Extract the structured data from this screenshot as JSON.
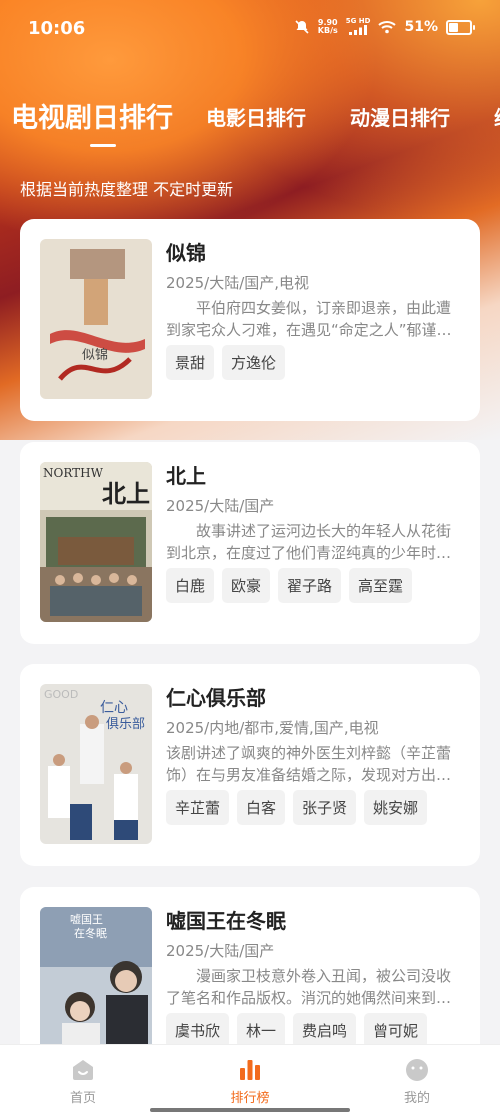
{
  "status_bar": {
    "time": "10:06",
    "net_speed": "9.90",
    "net_unit": "KB/s",
    "net_type": "5G HD",
    "battery": "51%",
    "icons": [
      "dnd-icon",
      "signal-icon",
      "wifi-icon",
      "battery-icon"
    ]
  },
  "tabs": [
    {
      "label": "电视剧日排行",
      "active": true
    },
    {
      "label": "电影日排行",
      "active": false
    },
    {
      "label": "动漫日排行",
      "active": false
    },
    {
      "label": "综",
      "active": false
    }
  ],
  "subtitle": "根据当前热度整理 不定时更新",
  "items": [
    {
      "title": "似锦",
      "meta": "2025/大陆/国产,电视",
      "desc": "平伯府四女姜似，订亲即退亲，由此遭到家宅众人刁难，在遇见“命定之人”郁谨后，两人联手查案，揭开重重阴谋。",
      "actors": [
        "景甜",
        "方逸伦"
      ]
    },
    {
      "title": "北上",
      "meta": "2025/大陆/国产",
      "desc": "故事讲述了运河边长大的年轻人从花街到北京，在度过了他们青涩纯真的少年时代后，在时代浪潮中奋斗前行。",
      "actors": [
        "白鹿",
        "欧豪",
        "翟子路",
        "高至霆"
      ]
    },
    {
      "title": "仁心俱乐部",
      "meta": "2025/内地/都市,爱情,国产,电视",
      "desc": "该剧讲述了飒爽的神外医生刘梓懿（辛芷蕾饰）在与男友准备结婚之际，发现对方出轨，从而与一群医生朋友携手成长。",
      "actors": [
        "辛芷蕾",
        "白客",
        "张子贤",
        "姚安娜"
      ]
    },
    {
      "title": "嘘国王在冬眠",
      "meta": "2025/大陆/国产",
      "desc": "漫画家卫枝意外卷入丑闻，被公司没收了笔名和作品版权。消沉的她偶然间来到滑雪场，遇到了滑雪教练单崇。",
      "actors": [
        "虞书欣",
        "林一",
        "费启鸣",
        "曾可妮"
      ]
    }
  ],
  "bottom_nav": [
    {
      "label": "首页",
      "icon": "home-icon",
      "active": false
    },
    {
      "label": "排行榜",
      "icon": "ranking-icon",
      "active": true
    },
    {
      "label": "我的",
      "icon": "profile-icon",
      "active": false
    }
  ],
  "colors": {
    "accent": "#f26b1d",
    "hero_dark": "#8e1d22",
    "hero_orange": "#f08a2c"
  }
}
